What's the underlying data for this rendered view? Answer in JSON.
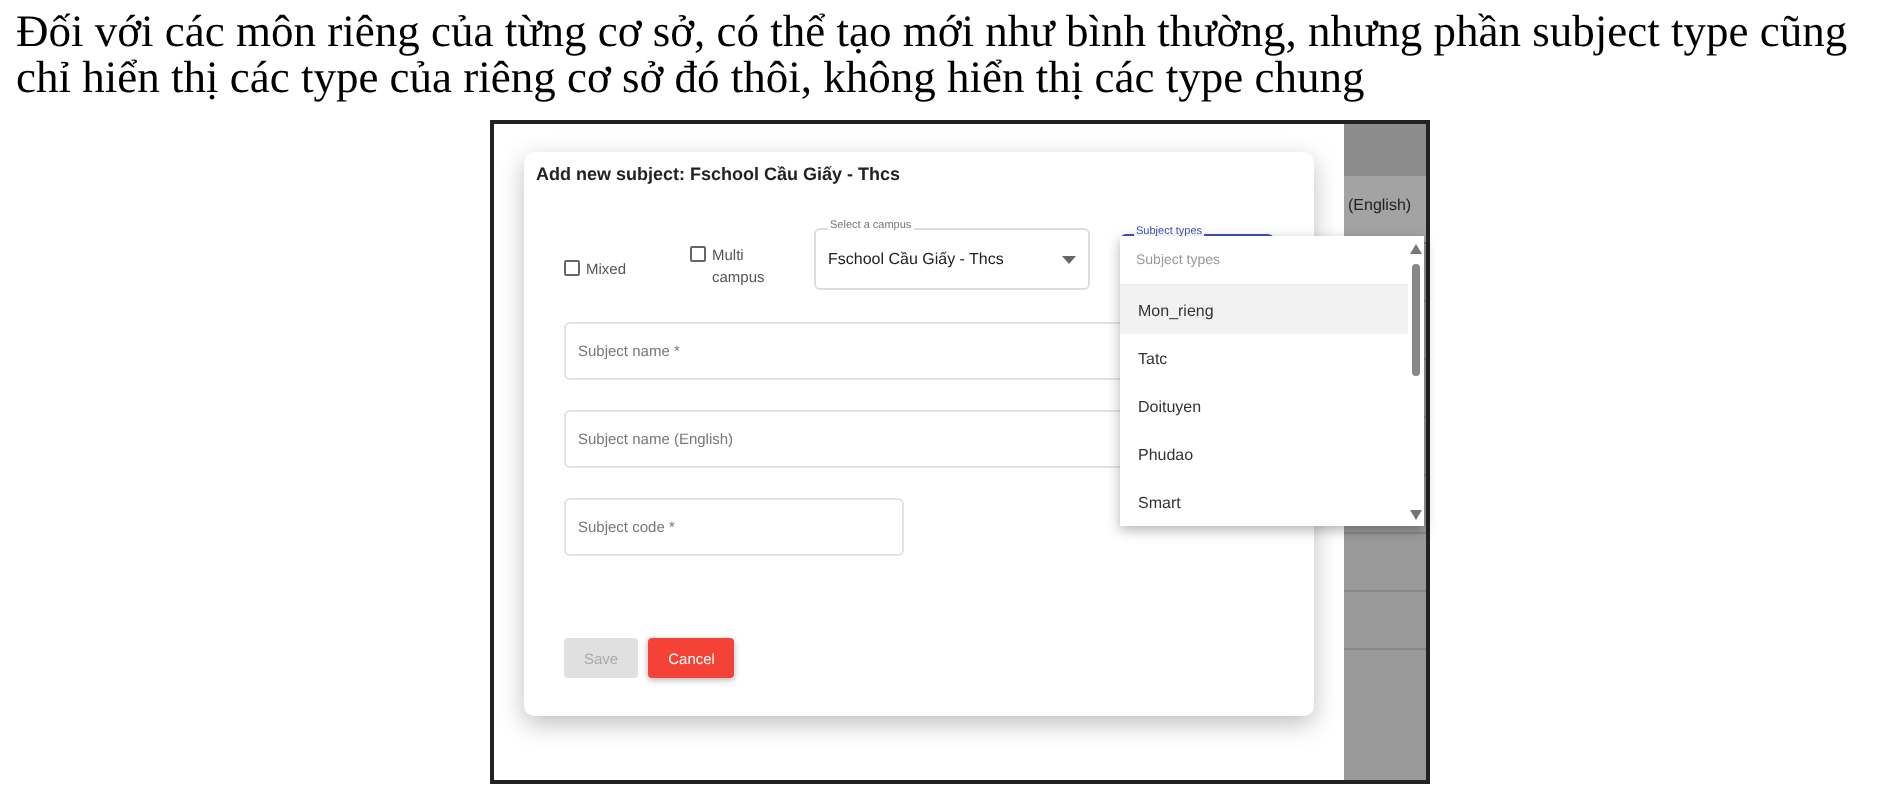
{
  "document": {
    "paragraph": "Đối với các môn riêng của từng cơ sở, có thể tạo mới như bình thường, nhưng phần subject type cũng chỉ hiển thị các type của riêng cơ sở đó thôi, không hiển thị các type chung"
  },
  "screenshot": {
    "background_table": {
      "column_header": "(English)"
    },
    "dialog": {
      "title": "Add new subject: Fschool Cầu Giấy - Thcs",
      "checkboxes": [
        {
          "label": "Mixed",
          "checked": false
        },
        {
          "label": "Multi campus",
          "checked": false
        }
      ],
      "campus_select": {
        "label": "Select a campus",
        "value": "Fschool Cầu Giấy - Thcs"
      },
      "subject_types": {
        "label": "Subject types"
      },
      "fields": [
        {
          "placeholder": "Subject name *",
          "kind": "full"
        },
        {
          "placeholder": "Subject name (English)",
          "kind": "full"
        },
        {
          "placeholder": "Subject code *",
          "kind": "short"
        }
      ],
      "buttons": [
        {
          "label": "Save",
          "kind": "primary",
          "disabled": true
        },
        {
          "label": "Cancel",
          "kind": "danger",
          "disabled": false
        }
      ]
    },
    "dropdown": {
      "search_placeholder": "Subject types",
      "options": [
        {
          "label": "Mon_rieng",
          "selected": true
        },
        {
          "label": "Tatc",
          "selected": false
        },
        {
          "label": "Doituyen",
          "selected": false
        },
        {
          "label": "Phudao",
          "selected": false
        },
        {
          "label": "Smart",
          "selected": false
        }
      ]
    }
  }
}
